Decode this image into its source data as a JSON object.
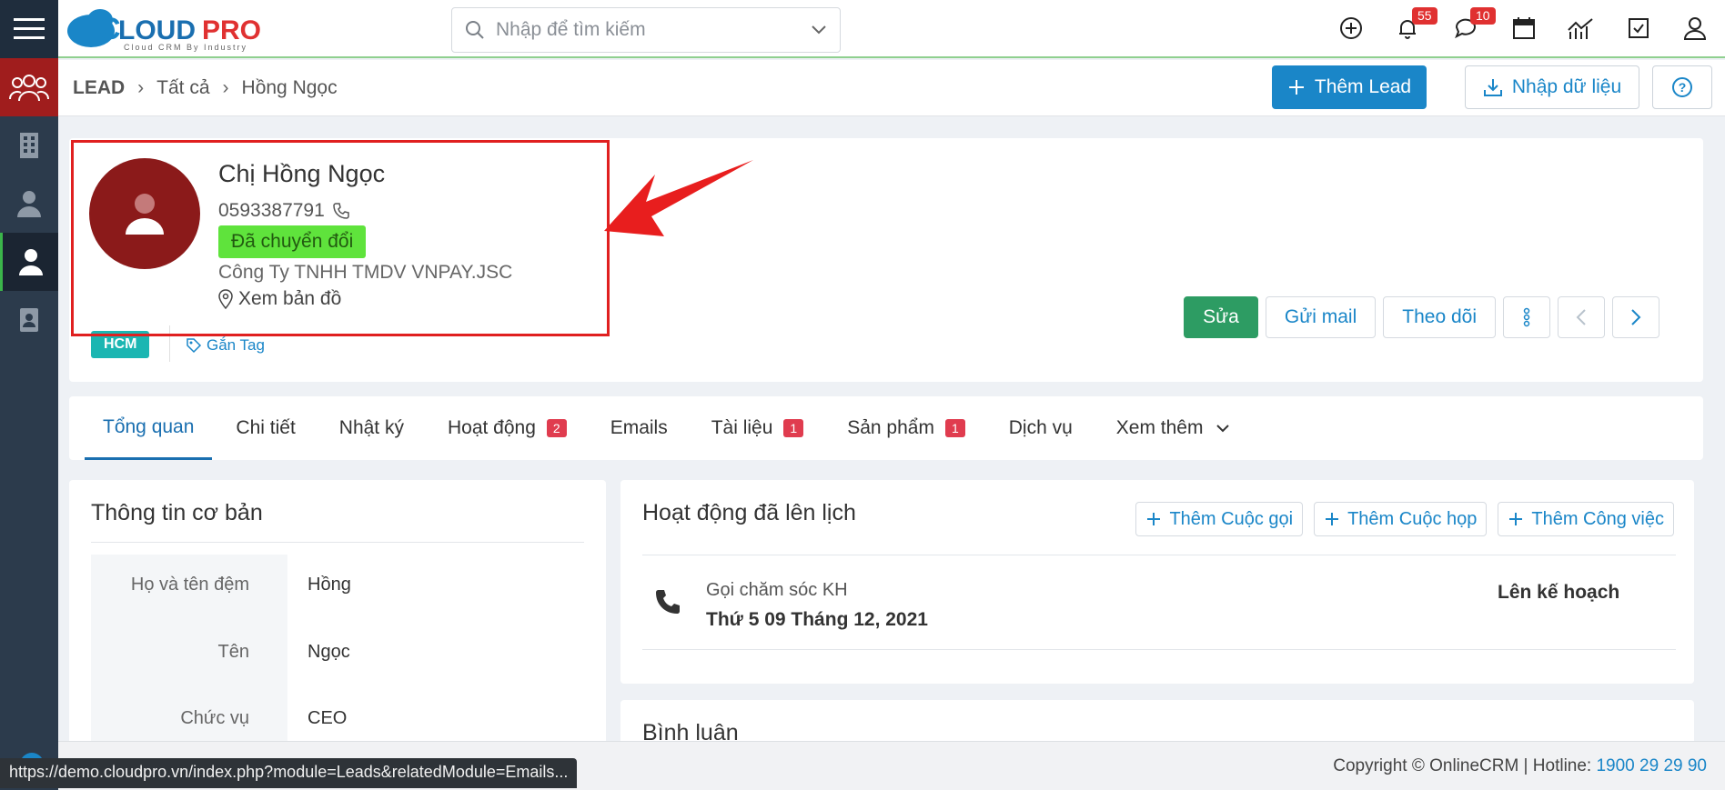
{
  "header": {
    "logo_text": "CLOUDPRO",
    "logo_tagline": "Cloud CRM By Industry",
    "search_placeholder": "Nhập để tìm kiếm",
    "notifications_count": "55",
    "messages_count": "10"
  },
  "breadcrumb": {
    "module": "LEAD",
    "level1": "Tất cả",
    "level2": "Hồng Ngọc"
  },
  "toolbar": {
    "add_label": "Thêm Lead",
    "import_label": "Nhập dữ liệu"
  },
  "profile": {
    "name": "Chị Hồng Ngọc",
    "phone": "0593387791",
    "status": "Đã chuyển đổi",
    "company": "Công Ty TNHH TMDV VNPAY.JSC",
    "map_link": "Xem bản đồ",
    "tag": "HCM",
    "add_tag": "Gắn Tag",
    "status_color": "#5fe33c",
    "avatar_color": "#8b1a1a"
  },
  "actions": {
    "edit": "Sửa",
    "send_mail": "Gửi mail",
    "follow": "Theo dõi"
  },
  "tabs": [
    {
      "label": "Tổng quan",
      "badge": ""
    },
    {
      "label": "Chi tiết",
      "badge": ""
    },
    {
      "label": "Nhật ký",
      "badge": ""
    },
    {
      "label": "Hoạt động",
      "badge": "2"
    },
    {
      "label": "Emails",
      "badge": ""
    },
    {
      "label": "Tài liệu",
      "badge": "1"
    },
    {
      "label": "Sản phẩm",
      "badge": "1"
    },
    {
      "label": "Dịch vụ",
      "badge": ""
    },
    {
      "label": "Xem thêm",
      "badge": ""
    }
  ],
  "basic_info": {
    "title": "Thông tin cơ bản",
    "fields": [
      {
        "label": "Họ và tên đệm",
        "value": "Hồng"
      },
      {
        "label": "Tên",
        "value": "Ngọc"
      },
      {
        "label": "Chức vụ",
        "value": "CEO"
      }
    ]
  },
  "activities": {
    "title": "Hoạt động đã lên lịch",
    "add_call": "Thêm Cuộc gọi",
    "add_meeting": "Thêm Cuộc họp",
    "add_task": "Thêm Công việc",
    "items": [
      {
        "title": "Gọi chăm sóc KH",
        "date": "Thứ 5 09 Tháng 12, 2021",
        "status": "Lên kế hoạch"
      }
    ]
  },
  "comments": {
    "title": "Bình luận"
  },
  "footer": {
    "copyright": "Copyright © OnlineCRM | Hotline:",
    "hotline": "1900 29 29 90",
    "status_url": "https://demo.cloudpro.vn/index.php?module=Leads&relatedModule=Emails..."
  },
  "colors": {
    "accent": "#1a86c8",
    "sidebar": "#2c3b4c",
    "primary_green": "#2d9c63",
    "badge_red": "#e03131",
    "highlight_red": "#e02020"
  }
}
